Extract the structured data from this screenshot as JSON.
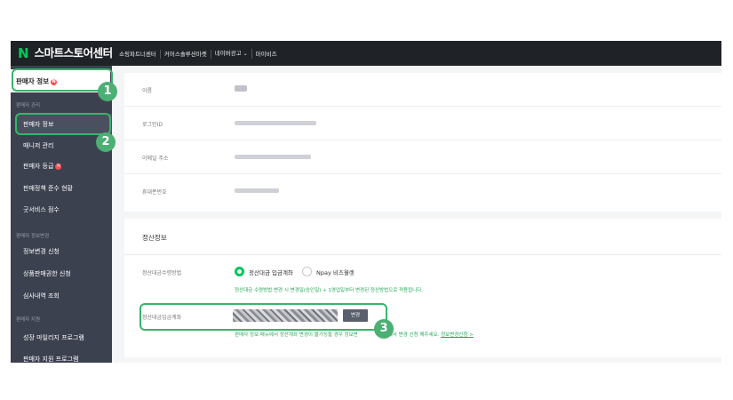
{
  "topbar": {
    "logo": "N",
    "title": "스마트스토어센터",
    "nav": [
      "쇼핑파트너센터",
      "커머스솔루션마켓",
      "네이버광고",
      "마이비즈"
    ]
  },
  "sidebar": {
    "top_item": "판매자 정보",
    "section1": "판매자 관리",
    "items1": [
      "판매자 정보",
      "매니저 관리",
      "판매자 등급",
      "판매정책 준수 현황",
      "굿서비스 점수"
    ],
    "section2": "판매자 정보변경",
    "items2": [
      "정보변경 신청",
      "상품판매권한 신청",
      "심사내역 조회"
    ],
    "section3": "판매자 지원",
    "items3": [
      "성장 마일리지 프로그램",
      "판매자 지원 프로그램"
    ],
    "new_badge": "N"
  },
  "profile": {
    "rows": [
      {
        "label": "이름"
      },
      {
        "label": "로그인ID"
      },
      {
        "label": "이메일 주소"
      },
      {
        "label": "휴대폰번호"
      }
    ]
  },
  "settlement": {
    "title": "정산정보",
    "method_label": "정산대금수령방법",
    "option1": "정산대금 입금계좌",
    "option2": "Npay 비즈월렛",
    "note1": "정산대금 수령방법 변경 시 변경일(승인일) + 1영업일부터 변경된 정산방법으로 적용됩니다.",
    "account_label": "정산대금입금계좌",
    "change_button": "변경",
    "note2_a": "판매자 정보 메뉴에서 정산계좌 변경이 불가능할 경우 정보변",
    "note2_b": "에서 변경 신청 해주세요.",
    "note2_link": "정보변경신청 >"
  },
  "markers": [
    "1",
    "2",
    "3"
  ],
  "colors": {
    "accent": "#03c75a",
    "highlight": "#35b56b",
    "sidebar": "#3c4150"
  }
}
